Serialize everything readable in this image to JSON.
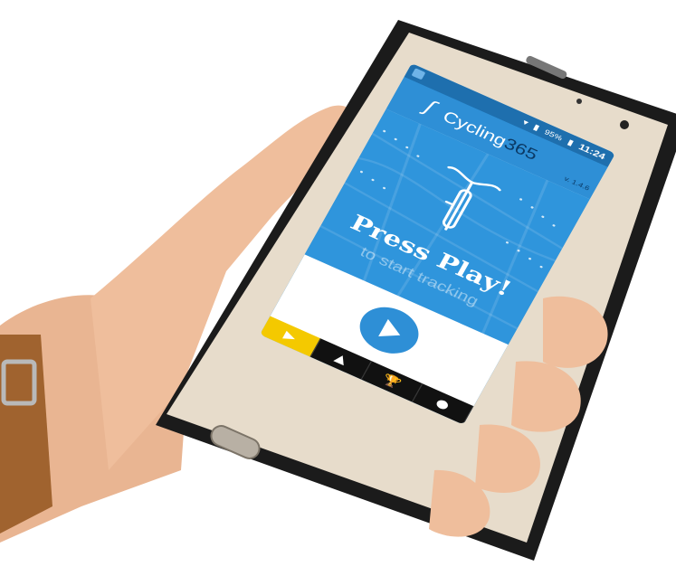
{
  "status_bar": {
    "battery": "95%",
    "time": "11:24"
  },
  "app": {
    "logo_word": "Cycling",
    "logo_number": "365",
    "version": "v. 1.4.6"
  },
  "hero": {
    "headline": "Press Play!",
    "subtext": "to start tracking"
  },
  "nav": {
    "tabs": [
      {
        "icon": "play-icon",
        "active": true
      },
      {
        "icon": "road-icon",
        "active": false
      },
      {
        "icon": "trophy-icon",
        "active": false
      },
      {
        "icon": "profile-icon",
        "active": false
      }
    ]
  },
  "colors": {
    "brand_blue": "#2e8fd6",
    "accent_yellow": "#f4c900",
    "phone_body": "#1b1b1b"
  }
}
